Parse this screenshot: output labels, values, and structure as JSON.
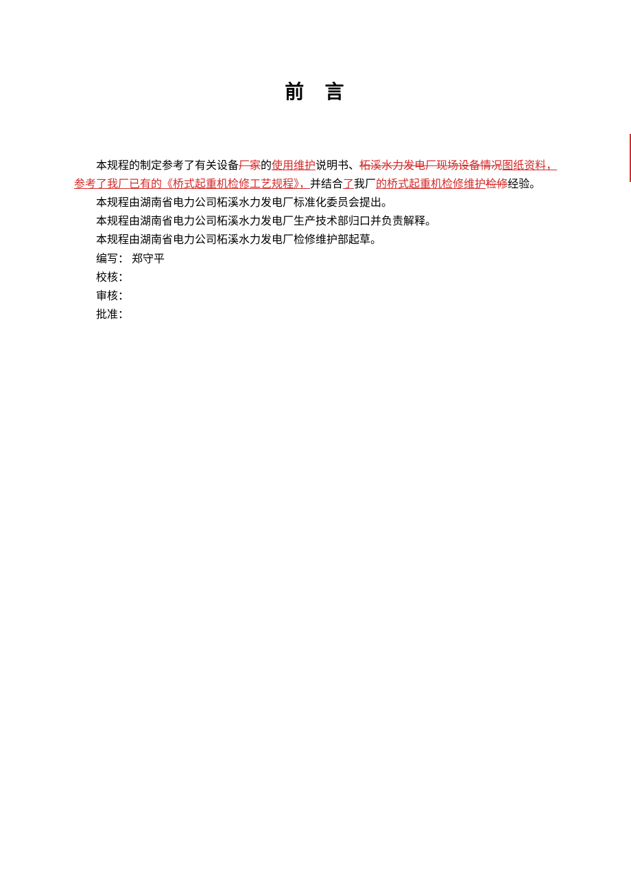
{
  "title": "前  言",
  "para1": {
    "t1": "本规程的制定参考了有关设备",
    "strike1": "厂家",
    "t2": "的",
    "underline1": "使用维护",
    "t3": "说明书、",
    "strike2": "柘溪水力发电厂现场设备情况",
    "underline2": "图纸资料，参考了我厂已有的《桥式起重机检修工艺规程》，",
    "t4": "并结合",
    "underline3": "了",
    "t5": "我厂",
    "underline4": "的桥式起重机检修维护",
    "strike3": "检修",
    "t6": "经验。"
  },
  "para2": "本规程由湖南省电力公司柘溪水力发电厂标准化委员会提出。",
  "para3": "本规程由湖南省电力公司柘溪水力发电厂生产技术部归口并负责解释。",
  "para4": "本规程由湖南省电力公司柘溪水力发电厂检修维护部起草。",
  "author": "编写：  郑守平",
  "checker": "校核：",
  "reviewer": "审核：",
  "approver": "批准："
}
